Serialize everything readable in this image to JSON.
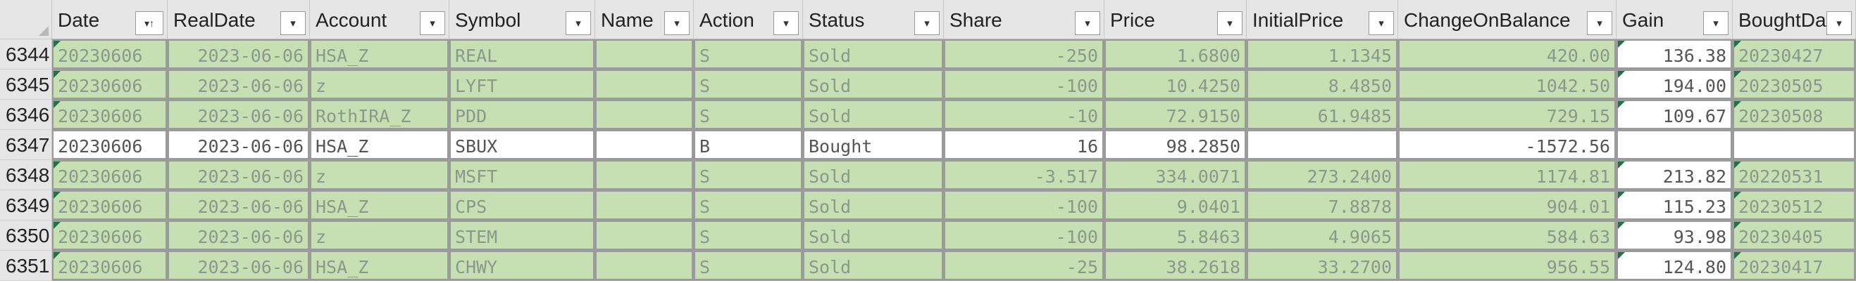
{
  "columns": [
    {
      "label": "Date",
      "sorted": true
    },
    {
      "label": "RealDate"
    },
    {
      "label": "Account"
    },
    {
      "label": "Symbol"
    },
    {
      "label": "Name"
    },
    {
      "label": "Action"
    },
    {
      "label": "Status"
    },
    {
      "label": "Share"
    },
    {
      "label": "Price"
    },
    {
      "label": "InitialPrice"
    },
    {
      "label": "ChangeOnBalance"
    },
    {
      "label": "Gain"
    },
    {
      "label": "BoughtDat"
    }
  ],
  "icons": {
    "dropdown": "▾",
    "sorted_dropdown": "▾↑"
  },
  "colors": {
    "highlight_fill": "#c6e0b4",
    "header_fill": "#e6e6e6",
    "error_indicator": "#217346"
  },
  "rows": [
    {
      "num": "6344",
      "highlight": true,
      "cells": [
        "20230606",
        "2023-06-06",
        "HSA_Z",
        "REAL",
        "",
        "S",
        "Sold",
        "-250",
        "1.6800",
        "1.1345",
        "420.00",
        "136.38",
        "20230427"
      ]
    },
    {
      "num": "6345",
      "highlight": true,
      "cells": [
        "20230606",
        "2023-06-06",
        "z",
        "LYFT",
        "",
        "S",
        "Sold",
        "-100",
        "10.4250",
        "8.4850",
        "1042.50",
        "194.00",
        "20230505"
      ]
    },
    {
      "num": "6346",
      "highlight": true,
      "cells": [
        "20230606",
        "2023-06-06",
        "RothIRA_Z",
        "PDD",
        "",
        "S",
        "Sold",
        "-10",
        "72.9150",
        "61.9485",
        "729.15",
        "109.67",
        "20230508"
      ]
    },
    {
      "num": "6347",
      "highlight": false,
      "cells": [
        "20230606",
        "2023-06-06",
        "HSA_Z",
        "SBUX",
        "",
        "B",
        "Bought",
        "16",
        "98.2850",
        "",
        "-1572.56",
        "",
        ""
      ]
    },
    {
      "num": "6348",
      "highlight": true,
      "cells": [
        "20230606",
        "2023-06-06",
        "z",
        "MSFT",
        "",
        "S",
        "Sold",
        "-3.517",
        "334.0071",
        "273.2400",
        "1174.81",
        "213.82",
        "20220531"
      ]
    },
    {
      "num": "6349",
      "highlight": true,
      "cells": [
        "20230606",
        "2023-06-06",
        "HSA_Z",
        "CPS",
        "",
        "S",
        "Sold",
        "-100",
        "9.0401",
        "7.8878",
        "904.01",
        "115.23",
        "20230512"
      ]
    },
    {
      "num": "6350",
      "highlight": true,
      "cells": [
        "20230606",
        "2023-06-06",
        "z",
        "STEM",
        "",
        "S",
        "Sold",
        "-100",
        "5.8463",
        "4.9065",
        "584.63",
        "93.98",
        "20230405"
      ]
    },
    {
      "num": "6351",
      "highlight": true,
      "cells": [
        "20230606",
        "2023-06-06",
        "HSA_Z",
        "CHWY",
        "",
        "S",
        "Sold",
        "-25",
        "38.2618",
        "33.2700",
        "956.55",
        "124.80",
        "20230417"
      ]
    }
  ]
}
